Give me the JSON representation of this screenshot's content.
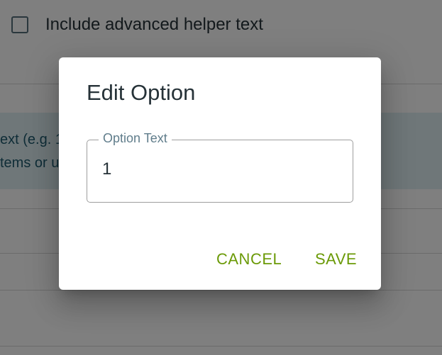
{
  "background": {
    "checkbox_label": "Include advanced helper text",
    "info_line_1": "ext (e.g. 1",
    "info_line_2": "tems or u"
  },
  "dialog": {
    "title": "Edit Option",
    "field": {
      "label": "Option Text",
      "value": "1"
    },
    "cancel_label": "CANCEL",
    "save_label": "SAVE"
  },
  "colors": {
    "accent": "#6b9a07",
    "overlay": "rgba(0,0,0,0.5)",
    "info_panel": "#dfeff3"
  }
}
